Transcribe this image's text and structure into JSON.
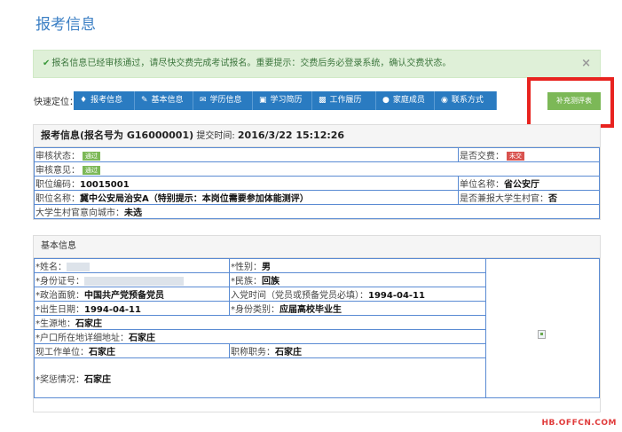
{
  "page": {
    "title": "报考信息"
  },
  "alert": {
    "message": "报名信息已经审核通过，请尽快交费完成考试报名。重要提示：交费后务必登录系统，确认交费状态。",
    "close_glyph": "×"
  },
  "quicknav": {
    "label": "快速定位：",
    "items": [
      {
        "label": "报考信息",
        "icon": "tag-icon"
      },
      {
        "label": "基本信息",
        "icon": "edit-icon"
      },
      {
        "label": "学历信息",
        "icon": "envelope-icon"
      },
      {
        "label": "学习简历",
        "icon": "book-icon"
      },
      {
        "label": "工作履历",
        "icon": "briefcase-icon"
      },
      {
        "label": "家庭成员",
        "icon": "globe-icon"
      },
      {
        "label": "联系方式",
        "icon": "chat-icon"
      }
    ]
  },
  "check_button": {
    "label": "补充测评表"
  },
  "baokao": {
    "title_bold": "报考信息(报名号为 G16000001)",
    "submit_label": "提交时间:",
    "submit_time": "2016/3/22 15:12:26",
    "rows": {
      "audit_status_label": "审核状态：",
      "audit_status_value": "通过",
      "paid_label": "是否交费：",
      "paid_value": "未交",
      "audit_opinion_label": "审核意见：",
      "audit_opinion_value": "通过",
      "position_code_label": "职位编码：",
      "position_code_value": "10015001",
      "unit_name_label": "单位名称：",
      "unit_name_value": "省公安厅",
      "position_name_label": "职位名称：",
      "position_name_value": "冀中公安局治安A（特别提示：本岗位需要参加体能测评）",
      "village_label": "是否兼报大学生村官：",
      "village_value": "否",
      "village_city_label": "大学生村官意向城市：",
      "village_city_value": "未选"
    }
  },
  "basic": {
    "title": "基本信息",
    "rows": {
      "name_label": "*姓名：",
      "gender_label": "*性别：",
      "gender_value": "男",
      "id_label": "*身份证号：",
      "ethnicity_label": "*民族：",
      "ethnicity_value": "回族",
      "political_label": "*政治面貌：",
      "political_value": "中国共产党预备党员",
      "party_date_label": "入党时间（党员或预备党员必填）：",
      "party_date_value": "1994-04-11",
      "birth_label": "*出生日期：",
      "birth_value": "1994-04-11",
      "identity_label": "*身份类别：",
      "identity_value": "应届高校毕业生",
      "origin_label": "*生源地：",
      "origin_value": "石家庄",
      "hukou_label": "*户口所在地详细地址：",
      "hukou_value": "石家庄",
      "work_unit_label": "现工作单位：",
      "work_unit_value": "石家庄",
      "title_job_label": "职称职务：",
      "title_job_value": "石家庄",
      "reward_label": "*奖惩情况：",
      "reward_value": "石家庄"
    }
  },
  "watermark": "HB.OFFCN.COM"
}
